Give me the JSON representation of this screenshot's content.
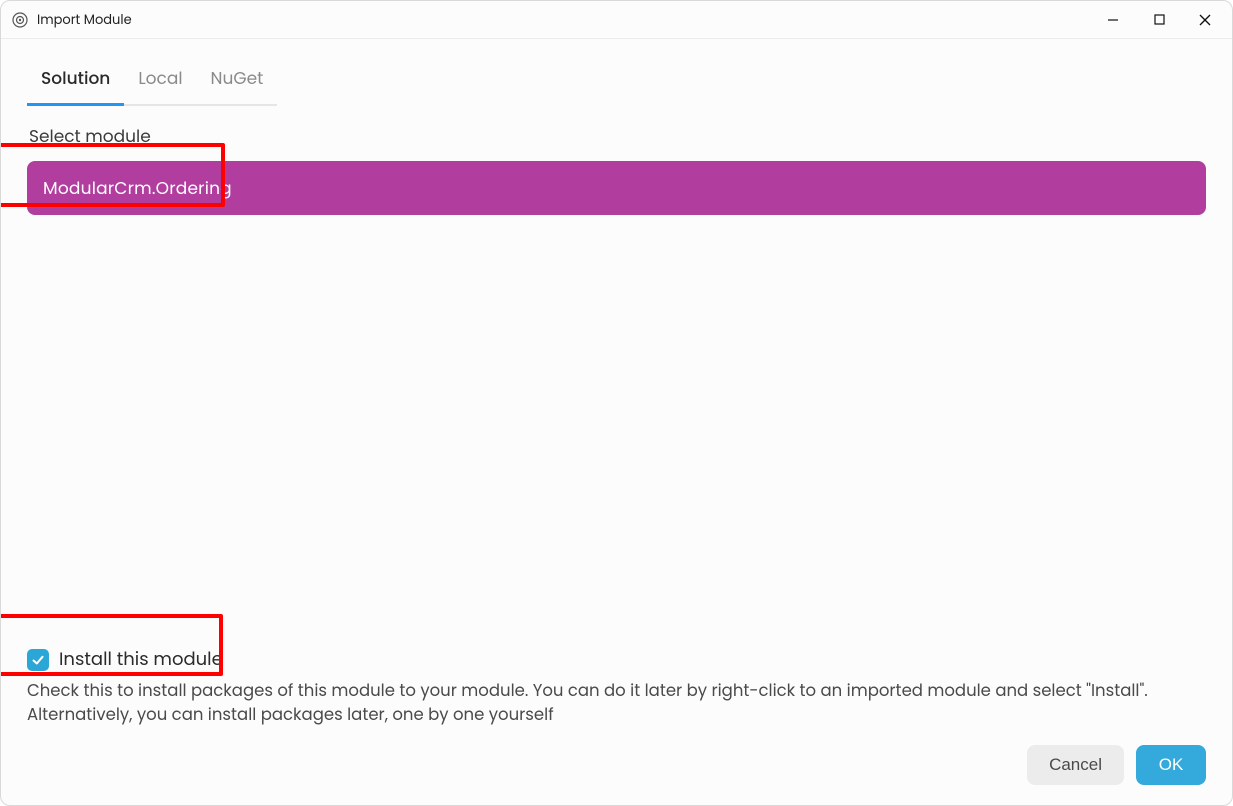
{
  "window": {
    "title": "Import Module"
  },
  "tabs": {
    "solution": "Solution",
    "local": "Local",
    "nuget": "NuGet"
  },
  "section": {
    "select_module_label": "Select module"
  },
  "modules": {
    "items": [
      {
        "name": "ModularCrm.Ordering"
      }
    ]
  },
  "install": {
    "checkbox_label": "Install this module",
    "help_text": "Check this to install packages of this module to your module. You can do it later by right-click to an imported module and select \"Install\". Alternatively, you can install packages later, one by one yourself"
  },
  "buttons": {
    "cancel": "Cancel",
    "ok": "OK"
  },
  "colors": {
    "accent_blue": "#34a9dc",
    "tab_underline": "#2196f3",
    "module_row_bg": "#b13d9e",
    "highlight_red": "#ff0000",
    "checkbox_bg": "#2aa7d6"
  }
}
